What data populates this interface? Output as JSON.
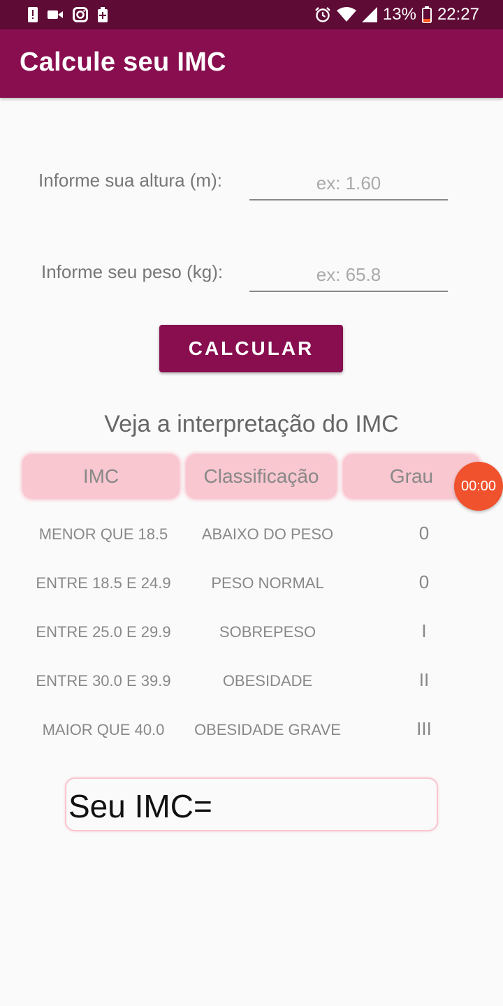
{
  "status_bar": {
    "battery": "13%",
    "time": "22:27",
    "icons_left": [
      "alert-icon",
      "video-icon",
      "instagram-icon",
      "battery-plus-icon"
    ],
    "icons_right": [
      "alarm-icon",
      "wifi-icon",
      "signal-icon",
      "battery-icon"
    ]
  },
  "app_bar": {
    "title": "Calcule seu IMC"
  },
  "form": {
    "height_label": "Informe sua altura (m):",
    "height_placeholder": "ex: 1.60",
    "weight_label": "Informe seu peso (kg):",
    "weight_placeholder": "ex: 65.8",
    "calculate_label": "CALCULAR"
  },
  "table": {
    "title": "Veja a interpretação do IMC",
    "headers": [
      "IMC",
      "Classificação",
      "Grau"
    ],
    "rows": [
      [
        "MENOR QUE 18.5",
        "ABAIXO DO PESO",
        "0"
      ],
      [
        "ENTRE 18.5 E 24.9",
        "PESO NORMAL",
        "0"
      ],
      [
        "ENTRE 25.0 E 29.9",
        "SOBREPESO",
        "I"
      ],
      [
        "ENTRE 30.0 E 39.9",
        "OBESIDADE",
        "II"
      ],
      [
        "MAIOR QUE 40.0",
        "OBESIDADE GRAVE",
        "III"
      ]
    ]
  },
  "result": {
    "label": "Seu IMC="
  },
  "timer": {
    "value": "00:00"
  },
  "colors": {
    "primary": "#880e4f",
    "status_bar": "#5e0b35",
    "accent_pink": "#f9c7d0",
    "timer": "#f0522e"
  }
}
